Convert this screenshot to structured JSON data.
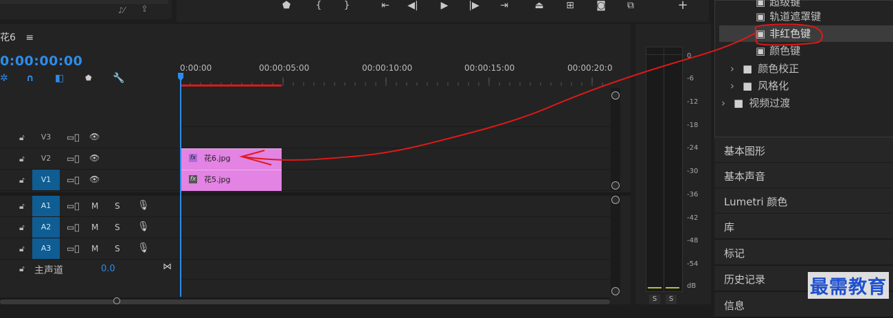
{
  "sequence": {
    "title": "花6",
    "menu_icon": "hamburger-icon",
    "timecode": "0:00:00:00"
  },
  "ruler": {
    "labels": [
      "0:00:00",
      "00:00:05:00",
      "00:00:10:00",
      "00:00:15:00",
      "00:00:20:0"
    ]
  },
  "tracks": {
    "video": [
      {
        "name": "V3",
        "selected": false
      },
      {
        "name": "V2",
        "selected": false
      },
      {
        "name": "V1",
        "selected": true
      }
    ],
    "audio": [
      {
        "name": "A1",
        "m": "M",
        "s": "S",
        "selected": true
      },
      {
        "name": "A2",
        "m": "M",
        "s": "S",
        "selected": true
      },
      {
        "name": "A3",
        "m": "M",
        "s": "S",
        "selected": true
      }
    ],
    "master": {
      "label": "主声道",
      "value": "0.0"
    }
  },
  "clips": [
    {
      "name": "花6.jpg",
      "fx": "fx",
      "track": "V2"
    },
    {
      "name": "花5.jpg",
      "fx": "fx",
      "track": "V1"
    }
  ],
  "meter": {
    "db_labels": [
      "0",
      "-6",
      "-12",
      "-18",
      "-24",
      "-30",
      "-36",
      "-42",
      "-48",
      "-54",
      "dB"
    ],
    "solo_left": "S",
    "solo_right": "S"
  },
  "effects": {
    "items": [
      {
        "label": "超级键",
        "type": "effect"
      },
      {
        "label": "轨道遮罩键",
        "type": "effect"
      },
      {
        "label": "非红色键",
        "type": "effect",
        "selected": true
      },
      {
        "label": "颜色键",
        "type": "effect"
      },
      {
        "label": "颜色校正",
        "type": "folder"
      },
      {
        "label": "风格化",
        "type": "folder"
      },
      {
        "label": "视频过渡",
        "type": "folder"
      }
    ]
  },
  "panels": [
    "基本图形",
    "基本声音",
    "Lumetri 颜色",
    "库",
    "标记",
    "历史记录",
    "信息"
  ],
  "watermark": "最需教育",
  "accent_color": "#2d8ceb",
  "clip_color": "#e383e3",
  "annotation_color": "#e01818"
}
